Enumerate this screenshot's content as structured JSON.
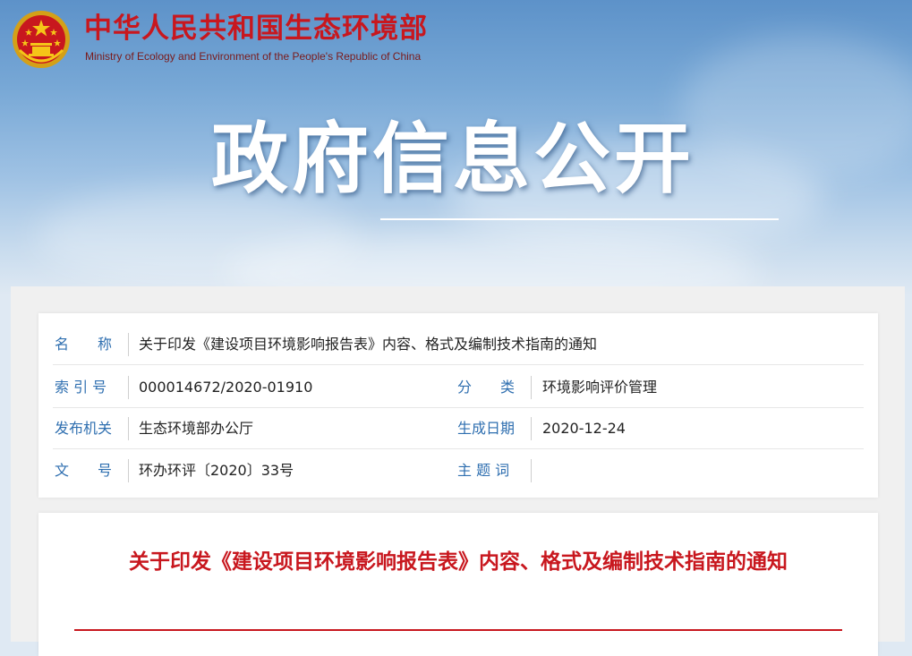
{
  "header": {
    "ministry_name_cn": "中华人民共和国生态环境部",
    "ministry_name_en": "Ministry of Ecology and Environment of the People's Republic of China",
    "emblem_icon": "national-emblem-icon",
    "banner_title": "政府信息公开"
  },
  "colors": {
    "brand_red": "#c8171e",
    "label_blue": "#2f6fb0",
    "banner_sky": "#78a8d6"
  },
  "metadata": {
    "name_label": "名　　称",
    "name_value": "关于印发《建设项目环境影响报告表》内容、格式及编制技术指南的通知",
    "index_label": "索 引 号",
    "index_value": "000014672/2020-01910",
    "category_label": "分　　类",
    "category_value": "环境影响评价管理",
    "issuer_label": "发布机关",
    "issuer_value": "生态环境部办公厅",
    "date_label": "生成日期",
    "date_value": "2020-12-24",
    "doc_no_label": "文　　号",
    "doc_no_value": "环办环评〔2020〕33号",
    "keywords_label": "主 题 词",
    "keywords_value": ""
  },
  "article": {
    "title": "关于印发《建设项目环境影响报告表》内容、格式及编制技术指南的通知"
  }
}
